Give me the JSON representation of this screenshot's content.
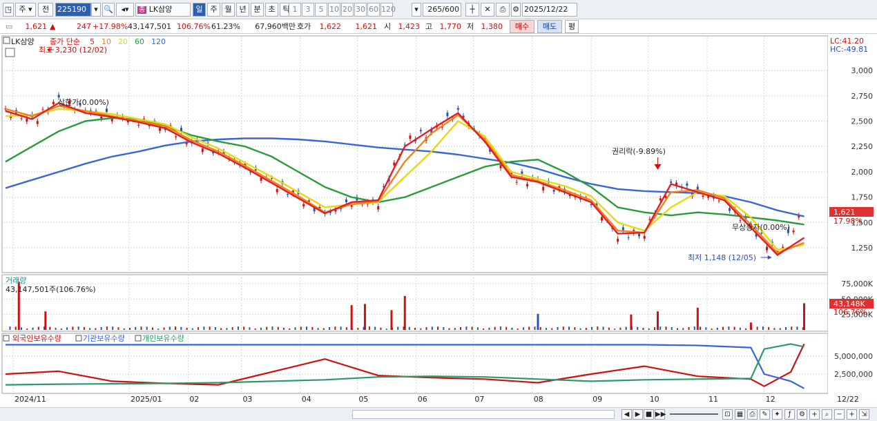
{
  "toolbar": {
    "period": "주",
    "market": "전",
    "code": "225190",
    "stock_name": "LK삼양",
    "tabs": [
      "일",
      "주",
      "월",
      "년",
      "분",
      "초",
      "틱"
    ],
    "active_tab": "일",
    "nums": [
      "1",
      "3",
      "5",
      "10",
      "20",
      "30",
      "60",
      "120"
    ],
    "count": "265",
    "count_total": "/600",
    "date": "2025/12/22"
  },
  "info": {
    "price": "1,621",
    "change": "247",
    "change_pct": "+17.98%",
    "volume": "43,147,501",
    "vol_ratio": "106.76%",
    "turnover": "61.23%",
    "amount": "67,960백만",
    "hoga_label": "호가",
    "ask": "1,622",
    "bid": "1,621",
    "open_label": "시",
    "open": "1,423",
    "high_label": "고",
    "high": "1,770",
    "low_label": "저",
    "low": "1,380",
    "buy_label": "매수",
    "sell_label": "매도",
    "eval_label": "평"
  },
  "price_panel": {
    "stock_label": "LK삼양",
    "ma_label": "종가 단순",
    "ma_periods": [
      {
        "p": "5",
        "color": "#e02020"
      },
      {
        "p": "10",
        "color": "#f08020"
      },
      {
        "p": "20",
        "color": "#e8d810"
      },
      {
        "p": "60",
        "color": "#2a9a3a"
      },
      {
        "p": "120",
        "color": "#3a64d8"
      }
    ],
    "high_note": "최고 3,230 (12/02)",
    "low_note": "최저 1,148 (12/05)",
    "ann_upper": "상한가(0.00%)",
    "ann_rights": "권리락(-9.89%)",
    "ann_capital": "무상증자(0.00%)",
    "lc": "LC:41.20",
    "hc": "HC:-49.81",
    "price_tag": "1,621",
    "pct_tag": "17.98%"
  },
  "volume_panel": {
    "title": "거래량",
    "value": "43,147,501주(106.76%)",
    "tag": "43,148K",
    "pct": "106.76%"
  },
  "holdings_panel": {
    "foreign": "외국인보유수량",
    "inst": "기관보유수량",
    "indiv": "개인보유수량"
  },
  "xaxis": [
    "2024/11",
    "2025/01",
    "02",
    "03",
    "04",
    "05",
    "06",
    "07",
    "08",
    "09",
    "10",
    "11",
    "12"
  ],
  "x_end": "12/22",
  "chart_data": [
    {
      "type": "line",
      "title": "LK삼양 종가 단순",
      "y_ticks": [
        3000,
        2750,
        2500,
        2250,
        2000,
        1750,
        1500,
        1250
      ],
      "y_tick_labels": [
        "3,000",
        "2,750",
        "2,500",
        "2,250",
        "2,000",
        "1,750",
        "1,500",
        "1,250"
      ],
      "ylim": [
        1040,
        3300
      ],
      "x_dates": [
        "2024-10-28",
        "2024-11-11",
        "2024-11-25",
        "2024-12-09",
        "2024-12-23",
        "2025-01-06",
        "2025-01-20",
        "2025-02-03",
        "2025-02-17",
        "2025-03-03",
        "2025-03-17",
        "2025-03-31",
        "2025-04-14",
        "2025-04-28",
        "2025-05-12",
        "2025-05-26",
        "2025-06-09",
        "2025-06-23",
        "2025-07-07",
        "2025-07-21",
        "2025-08-04",
        "2025-08-18",
        "2025-09-01",
        "2025-09-15",
        "2025-09-29",
        "2025-10-13",
        "2025-10-27",
        "2025-11-10",
        "2025-11-24",
        "2025-12-08",
        "2025-12-22"
      ],
      "close": [
        2600,
        2500,
        2700,
        2600,
        2550,
        2500,
        2450,
        2300,
        2200,
        2050,
        1900,
        1750,
        1580,
        1700,
        1700,
        2300,
        2400,
        2600,
        2300,
        1950,
        1900,
        1800,
        1700,
        1380,
        1400,
        1900,
        1800,
        1700,
        1450,
        1200,
        1621
      ],
      "series": [
        {
          "name": "5",
          "values": [
            2600,
            2520,
            2680,
            2580,
            2540,
            2490,
            2430,
            2290,
            2180,
            2040,
            1890,
            1740,
            1590,
            1700,
            1720,
            2250,
            2420,
            2580,
            2300,
            1950,
            1900,
            1800,
            1700,
            1390,
            1400,
            1880,
            1800,
            1720,
            1450,
            1180,
            1350
          ]
        },
        {
          "name": "10",
          "values": [
            2620,
            2550,
            2650,
            2600,
            2550,
            2500,
            2450,
            2310,
            2200,
            2060,
            1910,
            1760,
            1600,
            1680,
            1710,
            2100,
            2380,
            2560,
            2320,
            1970,
            1910,
            1820,
            1720,
            1420,
            1400,
            1800,
            1820,
            1740,
            1480,
            1200,
            1300
          ]
        },
        {
          "name": "20",
          "values": [
            2550,
            2560,
            2620,
            2600,
            2570,
            2520,
            2470,
            2340,
            2230,
            2090,
            1950,
            1800,
            1650,
            1680,
            1700,
            1950,
            2200,
            2500,
            2350,
            2000,
            1930,
            1860,
            1760,
            1500,
            1420,
            1650,
            1800,
            1760,
            1550,
            1230,
            1280
          ]
        },
        {
          "name": "60",
          "values": [
            2100,
            2250,
            2400,
            2500,
            2530,
            2520,
            2450,
            2360,
            2300,
            2250,
            2150,
            2000,
            1850,
            1750,
            1700,
            1750,
            1850,
            1950,
            2050,
            2100,
            2120,
            2000,
            1850,
            1650,
            1600,
            1570,
            1600,
            1580,
            1550,
            1520,
            1480
          ]
        },
        {
          "name": "120",
          "values": [
            1840,
            1920,
            2000,
            2080,
            2150,
            2200,
            2260,
            2300,
            2320,
            2330,
            2330,
            2320,
            2300,
            2270,
            2240,
            2220,
            2200,
            2170,
            2130,
            2090,
            2030,
            1950,
            1880,
            1830,
            1810,
            1800,
            1790,
            1760,
            1700,
            1620,
            1560
          ]
        }
      ]
    },
    {
      "type": "bar",
      "title": "거래량",
      "y_ticks": [
        75000,
        50000,
        25000
      ],
      "y_tick_labels": [
        "75,000K",
        "50,000K",
        "25,000K"
      ],
      "ylim": [
        0,
        85000
      ],
      "x_dates": [
        "2024-11-04",
        "2024-11-18",
        "2025-04-28",
        "2025-05-05",
        "2025-05-19",
        "2025-05-26",
        "2025-08-04",
        "2025-09-22",
        "2025-10-06",
        "2025-10-27",
        "2025-11-24",
        "2025-12-22"
      ],
      "values": [
        78000,
        30000,
        40000,
        42000,
        32000,
        55000,
        26000,
        25000,
        30000,
        36000,
        12000,
        43148
      ]
    },
    {
      "type": "line",
      "title": "보유수량",
      "y_ticks": [
        5000000,
        2500000
      ],
      "y_tick_labels": [
        "5,000,000",
        "2,500,000"
      ],
      "ylim": [
        0,
        7800000
      ],
      "x_dates": [
        "2024-10-28",
        "2024-11-25",
        "2024-12-23",
        "2025-01-20",
        "2025-02-17",
        "2025-03-17",
        "2025-04-14",
        "2025-05-12",
        "2025-06-09",
        "2025-07-07",
        "2025-08-04",
        "2025-09-01",
        "2025-09-29",
        "2025-10-27",
        "2025-11-24",
        "2025-12-01",
        "2025-12-15",
        "2025-12-22"
      ],
      "series": [
        {
          "name": "외국인보유수량",
          "values": [
            2500000,
            2900000,
            1500000,
            1200000,
            1000000,
            2800000,
            4600000,
            2300000,
            2000000,
            1800000,
            1300000,
            2500000,
            3600000,
            2200000,
            1800000,
            800000,
            2800000,
            6700000
          ]
        },
        {
          "name": "기관보유수량",
          "values": [
            6600000,
            6600000,
            6600000,
            6600000,
            6600000,
            6600000,
            6600000,
            6600000,
            6600000,
            6600000,
            6600000,
            6600000,
            6600000,
            6500000,
            6200000,
            2500000,
            1500000,
            500000
          ]
        },
        {
          "name": "개인보유수량",
          "values": [
            1000000,
            1100000,
            1150000,
            1200000,
            1300000,
            1500000,
            1700000,
            2100000,
            2200000,
            2100000,
            1800000,
            1500000,
            1700000,
            1800000,
            1900000,
            6000000,
            6700000,
            6300000
          ]
        }
      ]
    }
  ]
}
